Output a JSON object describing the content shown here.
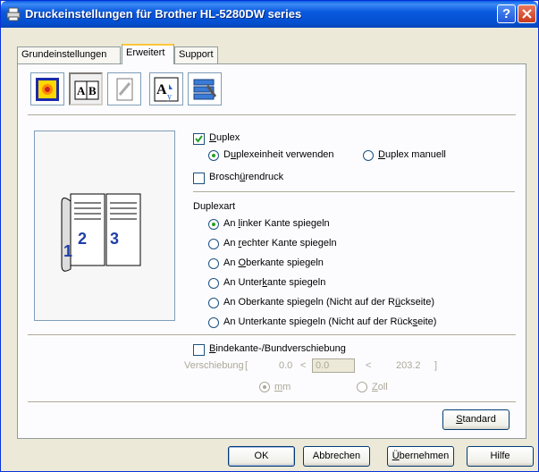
{
  "window": {
    "title": "Druckeinstellungen für Brother HL-5280DW series",
    "help_glyph": "?"
  },
  "tabs": [
    {
      "label": "Grundeinstellungen",
      "active": false
    },
    {
      "label": "Erweitert",
      "active": true
    },
    {
      "label": "Support",
      "active": false
    }
  ],
  "toolbar_icons": [
    {
      "icon": "color-icon",
      "pressed": false
    },
    {
      "icon": "duplex-ab-icon",
      "pressed": true
    },
    {
      "icon": "watermark-icon",
      "pressed": false
    },
    {
      "icon": "page-setting-icon",
      "pressed": false
    },
    {
      "icon": "device-options-icon",
      "pressed": false
    }
  ],
  "preview": {
    "numbers": [
      "1",
      "2",
      "3"
    ]
  },
  "duplex": {
    "checkbox": {
      "label_pre": "",
      "label_acc": "D",
      "label_post": "uplex",
      "checked": true
    },
    "unit": {
      "label_pre": "D",
      "label_acc": "u",
      "label_post": "plexeinheit verwenden",
      "selected": true
    },
    "manual": {
      "label_pre": "",
      "label_acc": "D",
      "label_post": "uplex manuell",
      "selected": false
    }
  },
  "brochure": {
    "label_pre": "Brosch",
    "label_acc": "ü",
    "label_post": "rendruck",
    "checked": false
  },
  "duplex_type": {
    "heading": "Duplexart",
    "options": [
      {
        "pre": "An ",
        "acc": "l",
        "post": "inker Kante spiegeln",
        "selected": true
      },
      {
        "pre": "An ",
        "acc": "r",
        "post": "echter Kante spiegeln",
        "selected": false
      },
      {
        "pre": "An ",
        "acc": "O",
        "post": "berkante spiegeln",
        "selected": false
      },
      {
        "pre": "An Unter",
        "acc": "k",
        "post": "ante spiegeln",
        "selected": false
      },
      {
        "pre": "An Oberkante spiegeln (Nicht auf der R",
        "acc": "ü",
        "post": "ckseite)",
        "selected": false
      },
      {
        "pre": "An Unterkante spiegeln (Nicht auf der Rück",
        "acc": "s",
        "post": "eite)",
        "selected": false
      }
    ]
  },
  "binding": {
    "checkbox": {
      "label_pre": "",
      "label_acc": "B",
      "label_post": "indekante-/Bundverschiebung",
      "checked": false
    },
    "offset_label": "Verschiebung",
    "bracket_open": "[",
    "min": "0.0",
    "lt1": "<",
    "value": "0.0",
    "lt2": "<",
    "max": "203.2",
    "bracket_close": "]",
    "unit_mm": {
      "acc": "m",
      "post": "m",
      "selected": true
    },
    "unit_zoll": {
      "acc": "Z",
      "post": "oll",
      "selected": false
    }
  },
  "buttons": {
    "standard": {
      "pre": "",
      "acc": "S",
      "post": "tandard"
    },
    "ok": "OK",
    "cancel": "Abbrechen",
    "apply": {
      "pre": "",
      "acc": "Ü",
      "post": "bernehmen"
    },
    "help": "Hilfe"
  },
  "colors": {
    "titlebar": "#0a5adf",
    "face": "#ece9d8",
    "active_tab": "#ffc73c",
    "radio_dot": "#21a121"
  }
}
